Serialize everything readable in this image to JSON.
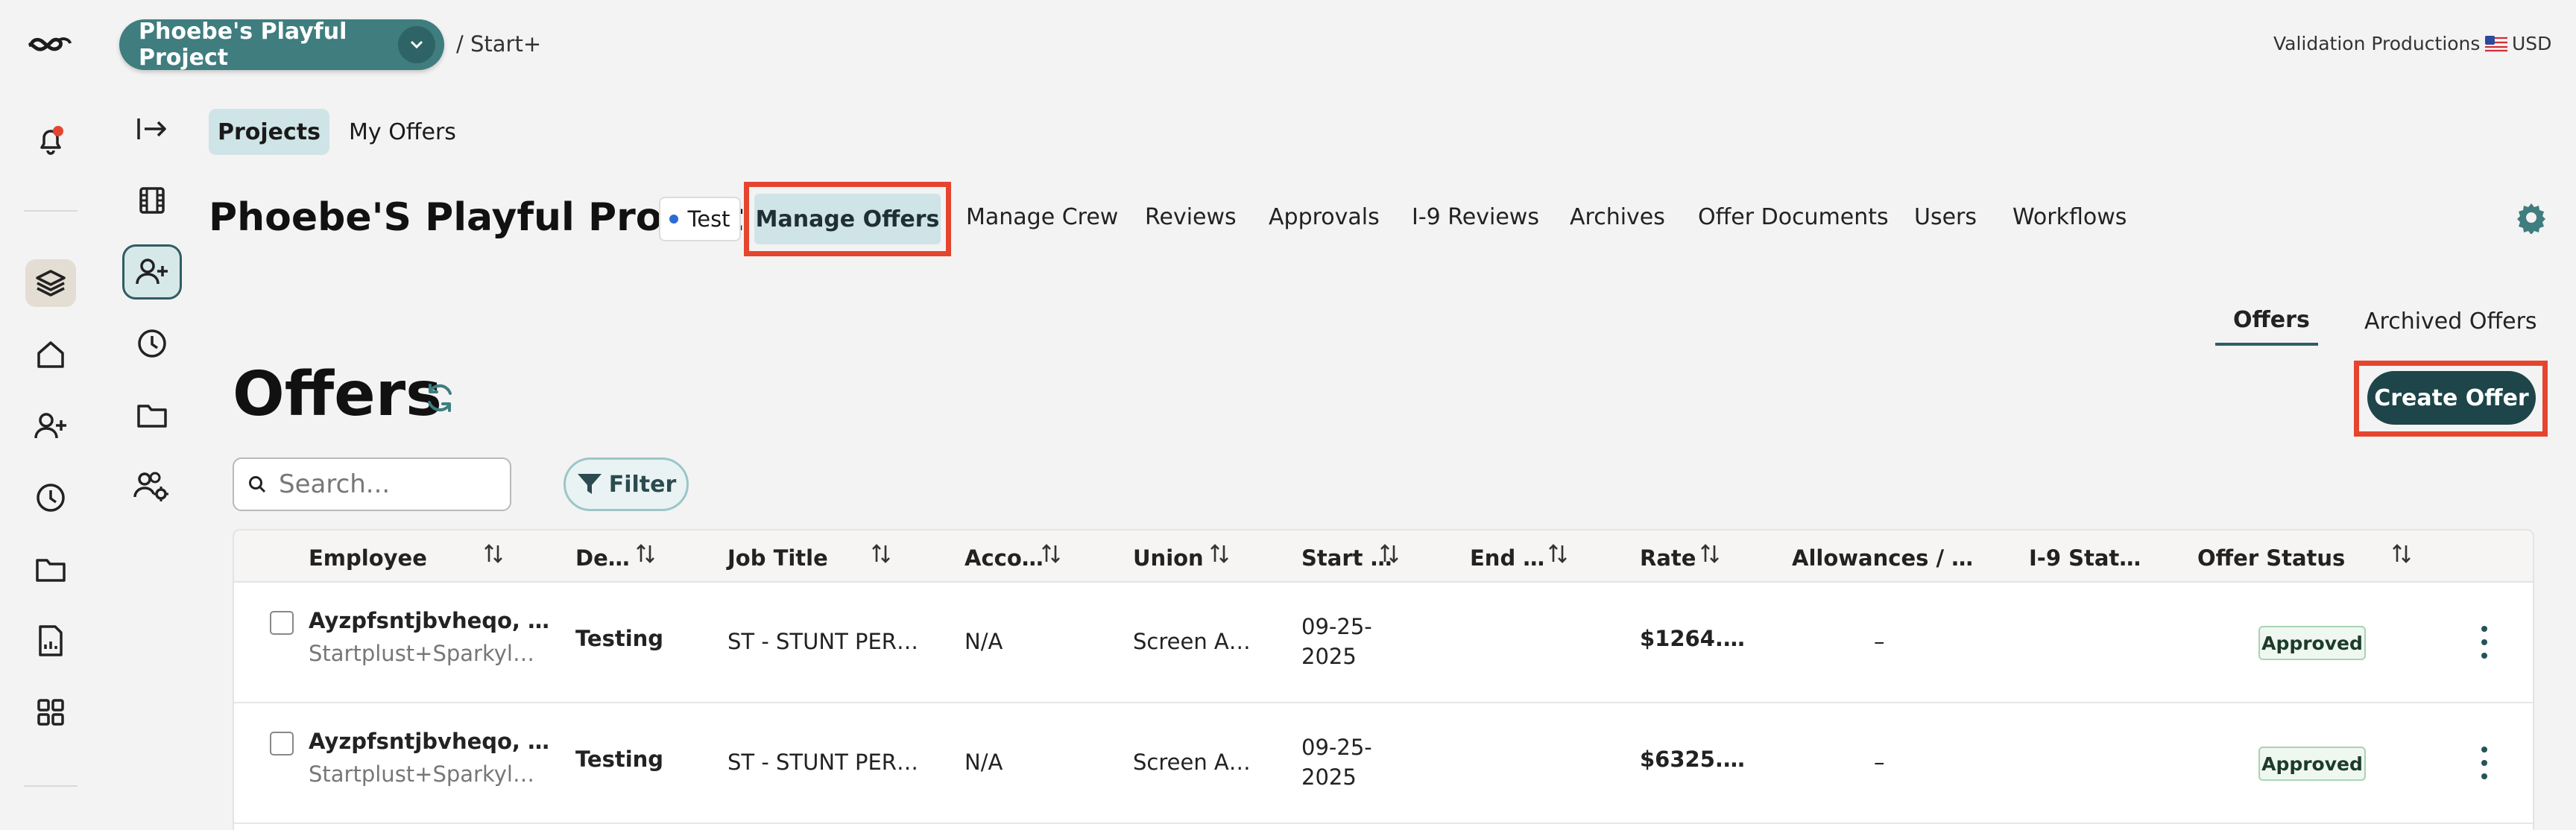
{
  "header": {
    "project_name": "Phoebe's Playful Project",
    "breadcrumb": "/ Start+",
    "company": "Validation Productions",
    "currency": "USD"
  },
  "subnav": {
    "projects_tab": "Projects",
    "my_offers_tab": "My Offers"
  },
  "project": {
    "title": "Phoebe'S Playful Project",
    "env_badge": "Test",
    "nav": [
      "Manage Offers",
      "Manage Crew",
      "Reviews",
      "Approvals",
      "I-9 Reviews",
      "Archives",
      "Offer Documents",
      "Users",
      "Workflows"
    ]
  },
  "offers": {
    "tabs": [
      "Offers",
      "Archived Offers"
    ],
    "heading": "Offers",
    "create_button": "Create Offer",
    "search_placeholder": "Search...",
    "filter_label": "Filter"
  },
  "table": {
    "headers": [
      "Employee",
      "De…",
      "Job Title",
      "Acco…",
      "Union",
      "Start …",
      "End …",
      "Rate",
      "Allowances / …",
      "I-9 Stat…",
      "Offer Status"
    ],
    "rows": [
      {
        "employee_name": "Ayzpfsntjbvheqo, …",
        "employee_sub": "Startplust+Sparkyl…",
        "department": "Testing",
        "job_title": "ST - STUNT PER…",
        "account": "N/A",
        "union": "Screen A…",
        "start_line1": "09-25-",
        "start_line2": "2025",
        "end": "",
        "rate": "$1264.…",
        "allowances": "–",
        "i9_status": "",
        "offer_status": "Approved"
      },
      {
        "employee_name": "Ayzpfsntjbvheqo, …",
        "employee_sub": "Startplust+Sparkyl…",
        "department": "Testing",
        "job_title": "ST - STUNT PER…",
        "account": "N/A",
        "union": "Screen A…",
        "start_line1": "09-25-",
        "start_line2": "2025",
        "end": "",
        "rate": "$6325.…",
        "allowances": "–",
        "i9_status": "",
        "offer_status": "Approved"
      }
    ]
  },
  "colors": {
    "accent": "#3f7d7f",
    "dark_accent": "#1e4549",
    "highlight_red": "#e5452e",
    "approved_bg": "#eef8f0"
  }
}
